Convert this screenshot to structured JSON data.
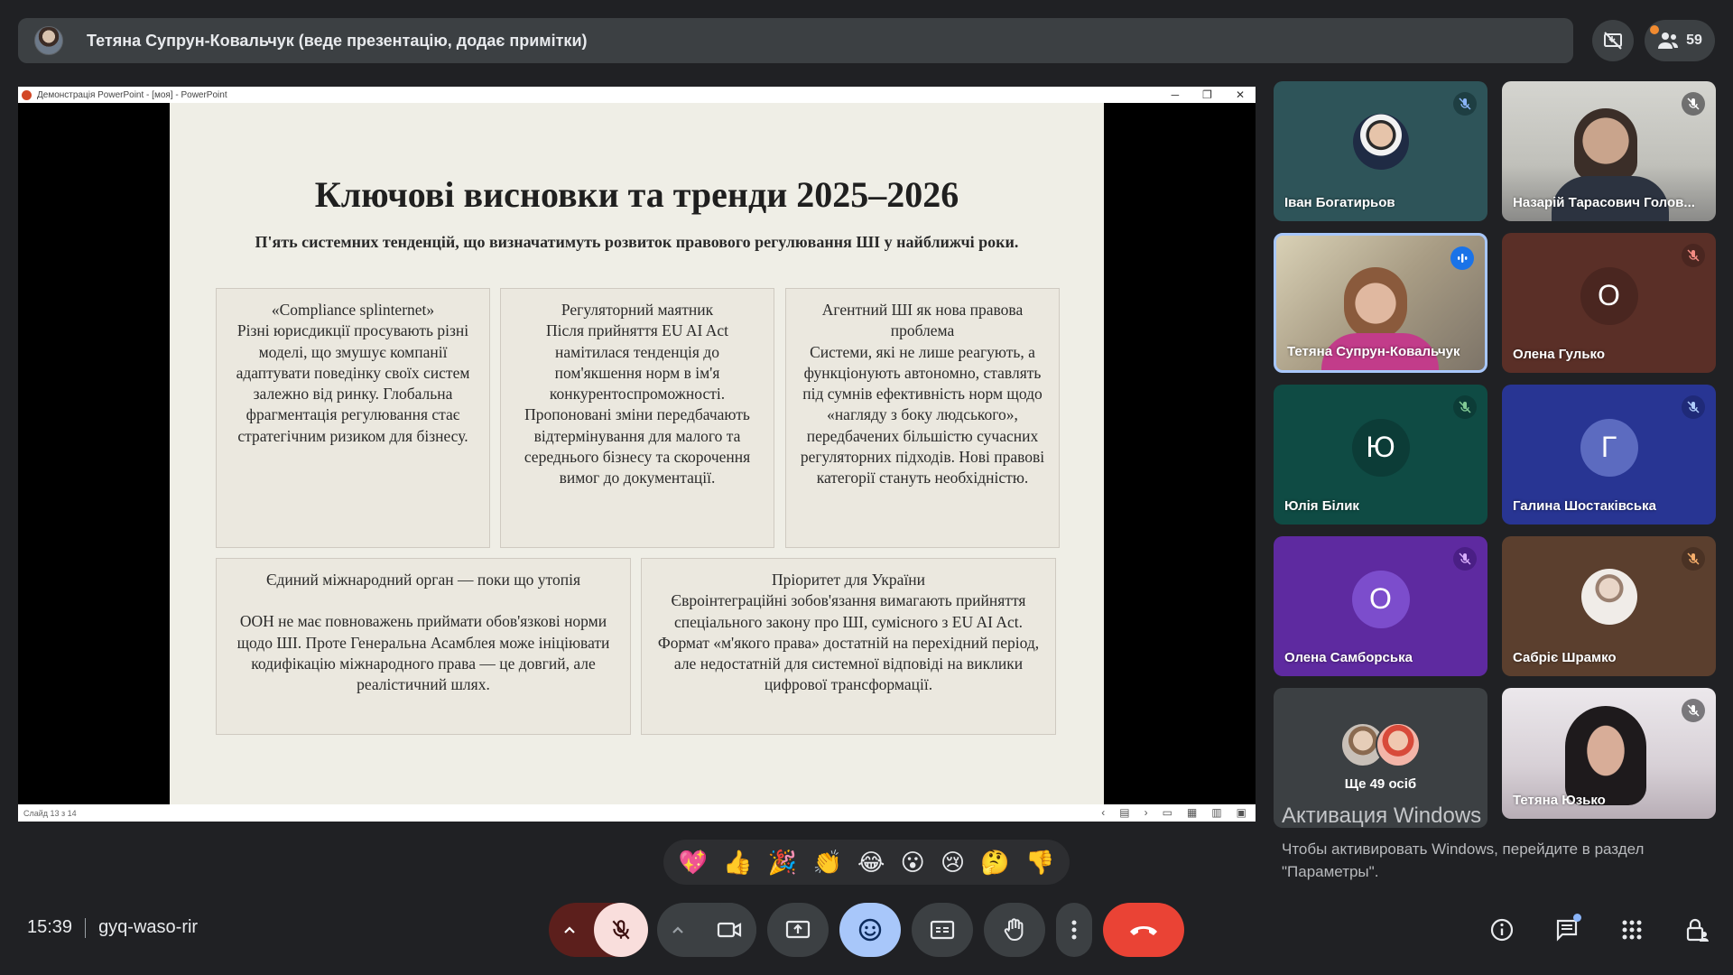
{
  "presenter_bar": {
    "title": "Тетяна Супрун-Ковальчук (веде презентацію, додає примітки)",
    "participant_count": "59"
  },
  "powerpoint": {
    "window_title": "Демонстрація PowerPoint - [моя] - PowerPoint",
    "status": "Слайд 13 з 14"
  },
  "slide": {
    "title": "Ключові висновки та тренди 2025–2026",
    "subtitle": "П'ять системних тенденцій, що визначатимуть розвиток правового регулювання ШІ у найближчі роки.",
    "cards": [
      {
        "head": "«Compliance splinternet»",
        "body": "Різні юрисдикції просувають різні моделі, що змушує компанії адаптувати поведінку своїх систем залежно від ринку. Глобальна фрагментація регулювання стає стратегічним ризиком для бізнесу."
      },
      {
        "head": "Регуляторний маятник",
        "body": "Після прийняття EU AI Act намітилася тенденція до пом'якшення норм в ім'я конкурентоспроможності. Пропоновані зміни передбачають відтермінування для малого та середнього бізнесу та скорочення вимог до документації."
      },
      {
        "head": "Агентний ШІ як нова правова проблема",
        "body": "Системи, які не лише реагують, а функціонують автономно, ставлять під сумнів ефективність норм щодо «нагляду з боку людського», передбачених більшістю сучасних регуляторних підходів. Нові правові категорії стануть необхідністю."
      },
      {
        "head": "Єдиний міжнародний орган — поки що утопія",
        "body": "ООН не має повноважень приймати обов'язкові норми щодо ШІ. Проте Генеральна Асамблея може ініціювати кодифікацію міжнародного права — це довгий, але реалістичний шлях."
      },
      {
        "head": "Пріоритет для України",
        "body": "Євроінтеграційні зобов'язання вимагають прийняття спеціального закону про ШІ, сумісного з EU AI Act. Формат «м'якого права» достатній на перехідний період, але недостатній для системної відповіді на виклики цифрової трансформації."
      }
    ]
  },
  "participants": [
    {
      "name": "Іван Богатирьов",
      "type": "photo",
      "bg": "#2e5459"
    },
    {
      "name": "Назарій Тарасович Голов...",
      "type": "video",
      "bg": "#c9c9c4"
    },
    {
      "name": "Тетяна Супрун-Ковальчук",
      "type": "video-speaking",
      "bg": "#b9a37c"
    },
    {
      "name": "Олена Гулько",
      "type": "letter",
      "letter": "О",
      "bg": "#5a2f27",
      "circle": "#4a2620"
    },
    {
      "name": "Юлія Білик",
      "type": "letter",
      "letter": "Ю",
      "bg": "#0f4b44",
      "circle": "#0c3c37"
    },
    {
      "name": "Галина Шостаківська",
      "type": "letter",
      "letter": "Г",
      "bg": "#283593",
      "circle": "#5c6bc0"
    },
    {
      "name": "Олена Самборська",
      "type": "letter",
      "letter": "О",
      "bg": "#5e2aa0",
      "circle": "#7c4dcc"
    },
    {
      "name": "Сабріє Шрамко",
      "type": "photo",
      "bg": "#5b3f2e"
    },
    {
      "name": "Ще 49 осіб",
      "type": "more",
      "bg": "#3c4043"
    },
    {
      "name": "Тетяна Юзько",
      "type": "video",
      "bg": "#d6d2d6"
    }
  ],
  "activation": {
    "title": "Активация Windows",
    "text": "Чтобы активировать Windows, перейдите в раздел \"Параметры\"."
  },
  "reactions": [
    "💖",
    "👍",
    "🎉",
    "👏",
    "😂",
    "😮",
    "😢",
    "🤔",
    "👎"
  ],
  "bottom": {
    "time": "15:39",
    "meeting_code": "gyq-waso-rir"
  },
  "colors": {
    "meet_bg": "#202124",
    "end_call": "#ea4335",
    "mic_off_bg": "#f9dedc",
    "active_btn": "#a8c7fa",
    "accent_blue": "#8ab4f8"
  }
}
